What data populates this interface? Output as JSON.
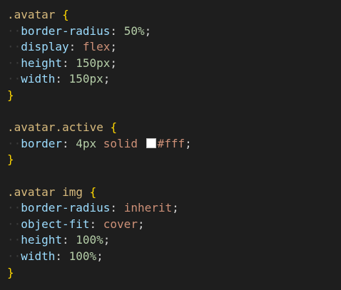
{
  "colors": {
    "background": "#1e1e1e",
    "selector": "#d7ba7d",
    "brace": "#ffd700",
    "property": "#9cdcfe",
    "number": "#b5cea8",
    "keyword": "#ce9178",
    "swatch": "#ffffff"
  },
  "blocks": [
    {
      "selector": ".avatar",
      "open": "{",
      "close": "}",
      "declarations": [
        {
          "property": "border-radius",
          "value": "50%"
        },
        {
          "property": "display",
          "value": "flex"
        },
        {
          "property": "height",
          "value": "150px"
        },
        {
          "property": "width",
          "value": "150px"
        }
      ]
    },
    {
      "selector": ".avatar.active",
      "open": "{",
      "close": "}",
      "declarations": [
        {
          "property": "border",
          "value_parts": [
            "4px",
            "solid",
            "#fff"
          ]
        }
      ]
    },
    {
      "selector": ".avatar img",
      "open": "{",
      "close": "}",
      "declarations": [
        {
          "property": "border-radius",
          "value": "inherit"
        },
        {
          "property": "object-fit",
          "value": "cover"
        },
        {
          "property": "height",
          "value": "100%"
        },
        {
          "property": "width",
          "value": "100%"
        }
      ]
    }
  ]
}
